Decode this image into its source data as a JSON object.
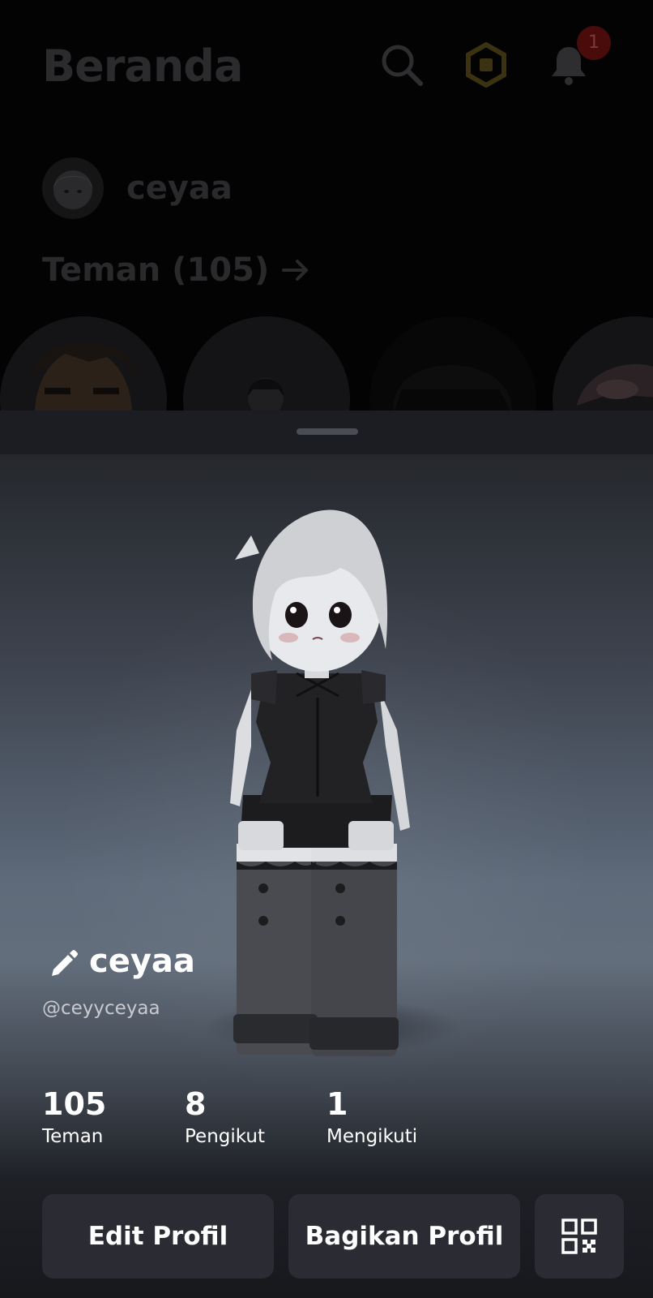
{
  "header": {
    "title": "Beranda",
    "notification_count": "1",
    "icons": [
      "search-icon",
      "robux-icon",
      "bell-icon"
    ]
  },
  "home_user": {
    "username": "ceyaa"
  },
  "friends_section": {
    "heading": "Teman (105)"
  },
  "profile": {
    "display_name": "ceyaa",
    "handle": "@ceyyceyaa"
  },
  "stats": [
    {
      "value": "105",
      "label": "Teman"
    },
    {
      "value": "8",
      "label": "Pengikut"
    },
    {
      "value": "1",
      "label": "Mengikuti"
    }
  ],
  "actions": {
    "edit_label": "Edit Profil",
    "share_label": "Bagikan Profil",
    "qr_icon": "qr-code-icon"
  },
  "colors": {
    "sheet_background": "#1c1d22",
    "button_background": "#2b2c33",
    "notification_badge": "#4a0b0b",
    "robux_accent": "#3a3210"
  }
}
